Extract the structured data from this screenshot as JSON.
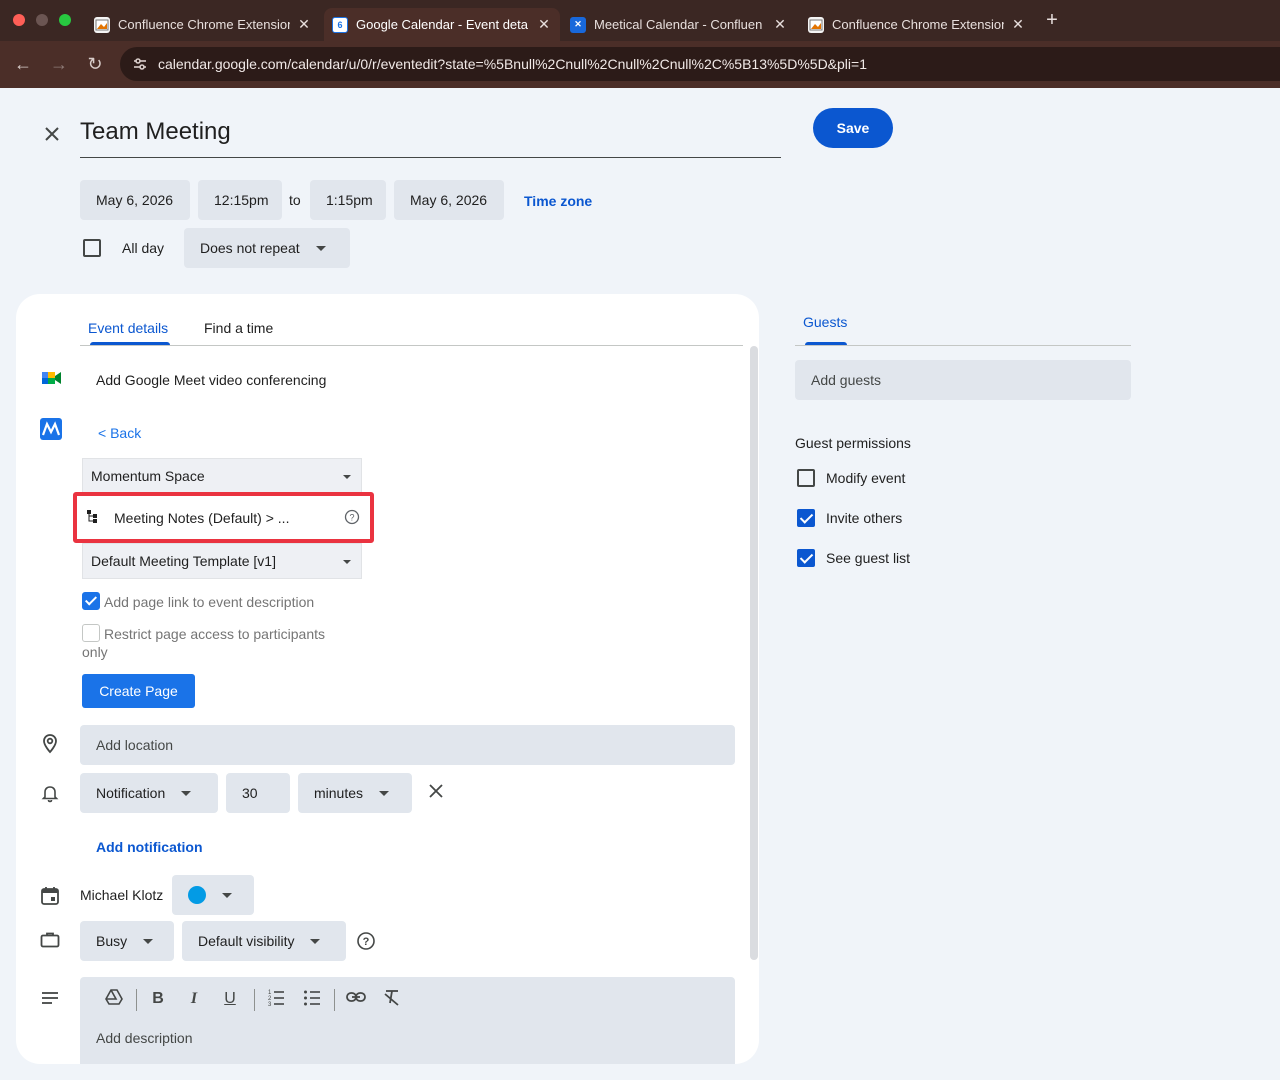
{
  "browser": {
    "tabs": [
      {
        "title": "Confluence Chrome Extension",
        "active": false
      },
      {
        "title": "Google Calendar - Event deta",
        "active": true
      },
      {
        "title": "Meetical Calendar - Confluen",
        "active": false
      },
      {
        "title": "Confluence Chrome Extension",
        "active": false
      }
    ],
    "new_tab": "+",
    "url": "calendar.google.com/calendar/u/0/r/eventedit?state=%5Bnull%2Cnull%2Cnull%2Cnull%2C%5B13%5D%5D&pli=1"
  },
  "event": {
    "title": "Team Meeting",
    "save_label": "Save",
    "start_date": "May 6, 2026",
    "start_time": "12:15pm",
    "to_label": "to",
    "end_time": "1:15pm",
    "end_date": "May 6, 2026",
    "timezone_label": "Time zone",
    "allday_label": "All day",
    "repeat_label": "Does not repeat"
  },
  "tabs": {
    "details": "Event details",
    "find_time": "Find a time"
  },
  "details": {
    "meet_label": "Add Google Meet video conferencing",
    "back_label": "< Back",
    "space_select": "Momentum Space",
    "parent_page": "Meeting Notes (Default) > ...",
    "template_select": "Default Meeting Template [v1]",
    "add_link_label": "Add page link to event description",
    "restrict_label": "Restrict page access to participants",
    "restrict_label_2": "only",
    "create_page_label": "Create Page",
    "location_placeholder": "Add location",
    "notification_type": "Notification",
    "notification_value": "30",
    "notification_unit": "minutes",
    "add_notification": "Add notification",
    "calendar_owner": "Michael Klotz",
    "calendar_color": "#039be5",
    "availability": "Busy",
    "visibility": "Default visibility",
    "description_placeholder": "Add description"
  },
  "guests": {
    "tab_label": "Guests",
    "add_placeholder": "Add guests",
    "permissions_title": "Guest permissions",
    "permissions": [
      {
        "label": "Modify event",
        "checked": false
      },
      {
        "label": "Invite others",
        "checked": true
      },
      {
        "label": "See guest list",
        "checked": true
      }
    ]
  },
  "colors": {
    "accent": "#0b57d0",
    "highlight": "#ea3340"
  }
}
